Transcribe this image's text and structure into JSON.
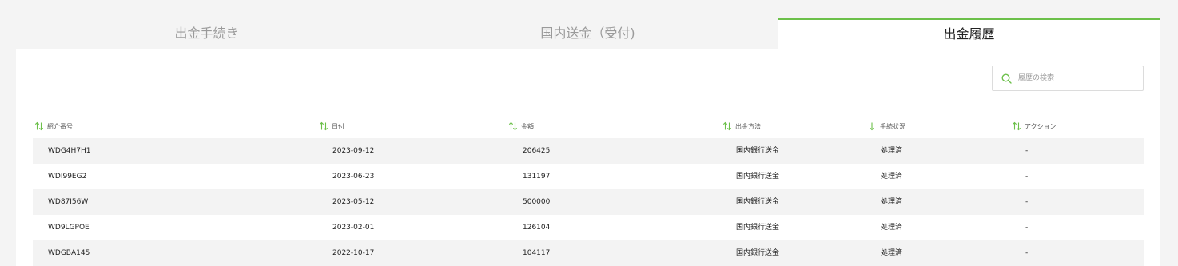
{
  "tabs": [
    {
      "label": "出金手続き",
      "active": false
    },
    {
      "label": "国内送金（受付)",
      "active": false
    },
    {
      "label": "出金履歴",
      "active": true
    }
  ],
  "search": {
    "placeholder": "履歴の検索",
    "value": ""
  },
  "table": {
    "columns": [
      {
        "label": "紹介番号",
        "sort_icon": "sort-both-icon"
      },
      {
        "label": "日付",
        "sort_icon": "sort-both-icon"
      },
      {
        "label": "金額",
        "sort_icon": "sort-both-icon"
      },
      {
        "label": "出金方法",
        "sort_icon": "sort-both-icon"
      },
      {
        "label": "手続状況",
        "sort_icon": "sort-down-icon"
      },
      {
        "label": "アクション",
        "sort_icon": "sort-both-icon"
      }
    ],
    "rows": [
      {
        "id": "WDG4H7H1",
        "date": "2023-09-12",
        "amount": "206425",
        "method": "国内銀行送金",
        "status": "処理済",
        "action": "-"
      },
      {
        "id": "WDI99EG2",
        "date": "2023-06-23",
        "amount": "131197",
        "method": "国内銀行送金",
        "status": "処理済",
        "action": "-"
      },
      {
        "id": "WD87I56W",
        "date": "2023-05-12",
        "amount": "500000",
        "method": "国内銀行送金",
        "status": "処理済",
        "action": "-"
      },
      {
        "id": "WD9LGPOE",
        "date": "2023-02-01",
        "amount": "126104",
        "method": "国内銀行送金",
        "status": "処理済",
        "action": "-"
      },
      {
        "id": "WDGBA145",
        "date": "2022-10-17",
        "amount": "104117",
        "method": "国内銀行送金",
        "status": "処理済",
        "action": "-"
      }
    ]
  },
  "colors": {
    "accent": "#6cc04a",
    "row_stripe": "#f3f3f3",
    "background": "#f4f4f4"
  }
}
